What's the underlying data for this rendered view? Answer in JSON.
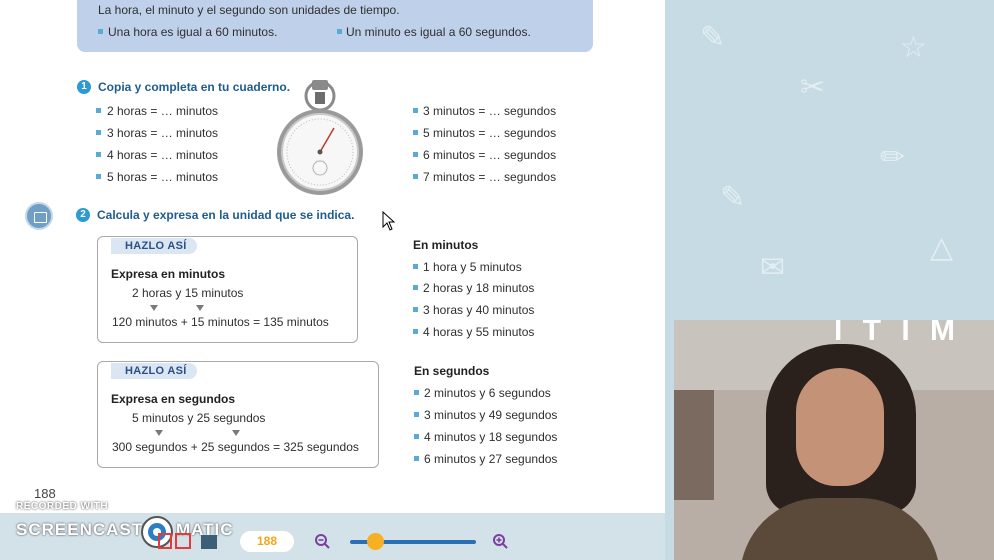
{
  "intro": {
    "line": "La hora, el minuto y el segundo son unidades de tiempo.",
    "fact1": "Una hora es igual a 60 minutos.",
    "fact2": "Un minuto es igual a 60 segundos."
  },
  "ex1": {
    "number": "1",
    "title": "Copia y completa en tu cuaderno.",
    "left": [
      "2 horas = … minutos",
      "3 horas = … minutos",
      "4 horas = … minutos",
      "5 horas = … minutos"
    ],
    "right": [
      "3 minutos = … segundos",
      "5 minutos = … segundos",
      "6 minutos = … segundos",
      "7 minutos = … segundos"
    ]
  },
  "ex2": {
    "number": "2",
    "title": "Calcula y expresa en la unidad que se indica.",
    "box1": {
      "tag": "HAZLO ASÍ",
      "title": "Expresa en minutos",
      "line1": "2  horas  y  15  minutos",
      "line2": "120 minutos +  15 minutos = 135 minutos"
    },
    "box2": {
      "tag": "HAZLO ASÍ",
      "title": "Expresa en segundos",
      "line1": "5 minutos  y 25 segundos",
      "line2": "300 segundos + 25 segundos = 325 segundos"
    },
    "minutes_heading": "En minutos",
    "minutes": [
      "1 hora y 5 minutos",
      "2 horas y 18 minutos",
      "3 horas y 40 minutos",
      "4 horas y 55 minutos"
    ],
    "seconds_heading": "En segundos",
    "seconds": [
      "2 minutos y 6 segundos",
      "3 minutos y 49 segundos",
      "4 minutos y 18 segundos",
      "6 minutos y 27 segundos"
    ]
  },
  "page_number": "188",
  "watermark": {
    "top": "RECORDED WITH",
    "bottom_left": "SCREENCAST",
    "bottom_right": "MATIC"
  },
  "toolbar": {
    "page_pill": "188",
    "zoom_level": 0.2
  },
  "webcam_sign": "Ι Τ Ι Μ Α"
}
